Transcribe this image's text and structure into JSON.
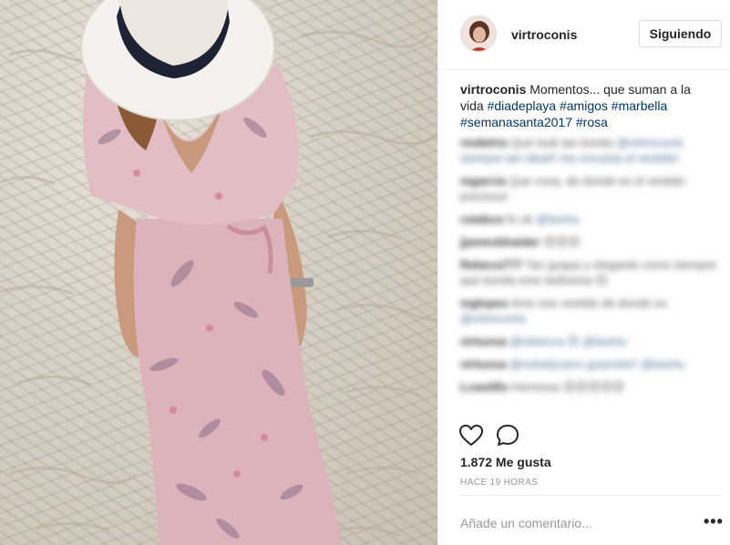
{
  "post": {
    "username": "virtroconis",
    "follow_label": "Siguiendo",
    "caption": {
      "username": "virtroconis",
      "text": " Momentos... que suman a la vida ",
      "hashtags": [
        "#diadeplaya",
        "#amigos",
        "#marbella",
        "#semanasanta2017",
        "#rosa"
      ]
    },
    "comments": [
      {
        "user": "rmdelrio",
        "text": "Qué look tan bonito ",
        "mention": "@virtroconis siempre tan ideal!! me encanta el vestido!"
      },
      {
        "user": "mgarcia",
        "text": "Que cosa, de donde es el vestido precioso!",
        "mention": ""
      },
      {
        "user": "rotabus",
        "text": "fo ok ",
        "mention": "@lavirtu"
      },
      {
        "user": "jjamesbhaider",
        "text": "😊😊😊",
        "mention": ""
      },
      {
        "user": "Rebeca777",
        "text": "Tan guapa y elegante como siempre que bonita eres bellísima 😊",
        "mention": ""
      },
      {
        "user": "mglopez",
        "text": "Amo ese vestido de donde es ",
        "mention": "@virtroconis"
      },
      {
        "user": "virtuosa",
        "text": "",
        "mention": "@rebecca 😊 @lavirtu"
      },
      {
        "user": "virtuosa",
        "text": "",
        "mention": "@nohelycarro guarrete!! @lavirtu"
      },
      {
        "user": "Lcastillo",
        "text": "Hermosa 😊😊😊😊😊",
        "mention": ""
      }
    ],
    "icons": {
      "like": "heart-outline-icon",
      "comment": "comment-bubble-icon",
      "more": "ellipsis-icon"
    },
    "likes_label": "1.872 Me gusta",
    "time_label": "HACE 19 HORAS",
    "comment_placeholder": "Añade un comentario...",
    "more_label": "•••"
  },
  "colors": {
    "hashtag": "#003569",
    "border": "#efefef",
    "muted": "#999999"
  }
}
